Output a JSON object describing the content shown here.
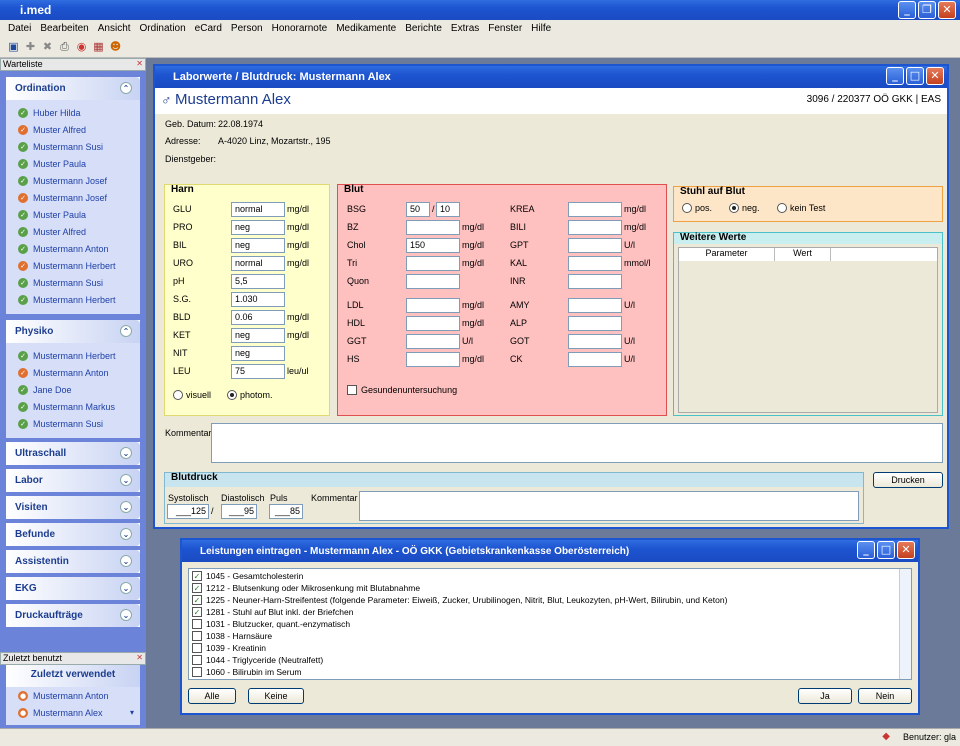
{
  "app": {
    "title": "i.med"
  },
  "menu": [
    "Datei",
    "Bearbeiten",
    "Ansicht",
    "Ordination",
    "eCard",
    "Person",
    "Honorarnote",
    "Medikamente",
    "Berichte",
    "Extras",
    "Fenster",
    "Hilfe"
  ],
  "sidebar": {
    "title": "Warteliste",
    "groups": [
      {
        "label": "Ordination",
        "expanded": true,
        "items": [
          "Huber Hilda",
          "Muster Alfred",
          "Mustermann Susi",
          "Muster Paula",
          "Mustermann Josef",
          "Mustermann Josef",
          "Muster Paula",
          "Muster Alfred",
          "Mustermann Anton",
          "Mustermann Herbert",
          "Mustermann Susi",
          "Mustermann Herbert"
        ]
      },
      {
        "label": "Physiko",
        "expanded": true,
        "items": [
          "Mustermann Herbert",
          "Mustermann Anton",
          "Jane Doe",
          "Mustermann Markus",
          "Mustermann Susi"
        ]
      },
      {
        "label": "Ultraschall"
      },
      {
        "label": "Labor"
      },
      {
        "label": "Visiten"
      },
      {
        "label": "Befunde"
      },
      {
        "label": "Assistentin"
      },
      {
        "label": "EKG"
      },
      {
        "label": "Druckaufträge"
      }
    ],
    "recent_title": "Zuletzt benutzt",
    "recent_heading": "Zuletzt verwendet",
    "recent": [
      "Mustermann Anton",
      "Mustermann Alex"
    ]
  },
  "main": {
    "title": "Laborwerte / Blutdruck: Mustermann Alex",
    "patient_name": "Mustermann Alex",
    "patient_id": "3096 / 220377 OÖ GKK | EAS",
    "geb_label": "Geb. Datum:",
    "geb_value": "22.08.1974",
    "adr_label": "Adresse:",
    "adr_value": "A-4020 Linz, Mozartstr., 195",
    "dienst_label": "Dienstgeber:",
    "harn": {
      "title": "Harn",
      "rows": [
        {
          "label": "GLU",
          "value": "normal",
          "unit": "mg/dl"
        },
        {
          "label": "PRO",
          "value": "neg",
          "unit": "mg/dl"
        },
        {
          "label": "BIL",
          "value": "neg",
          "unit": "mg/dl"
        },
        {
          "label": "URO",
          "value": "normal",
          "unit": "mg/dl"
        },
        {
          "label": "pH",
          "value": "5,5",
          "unit": ""
        },
        {
          "label": "S.G.",
          "value": "1.030",
          "unit": ""
        },
        {
          "label": "BLD",
          "value": "0.06",
          "unit": "mg/dl"
        },
        {
          "label": "KET",
          "value": "neg",
          "unit": "mg/dl"
        },
        {
          "label": "NIT",
          "value": "neg",
          "unit": ""
        },
        {
          "label": "LEU",
          "value": "75",
          "unit": "leu/ul"
        }
      ],
      "radio_visuell": "visuell",
      "radio_photom": "photom."
    },
    "blut": {
      "title": "Blut",
      "left": [
        {
          "label": "BSG",
          "value": "50",
          "value2": "10",
          "unit": ""
        },
        {
          "label": "BZ",
          "value": "",
          "unit": "mg/dl"
        },
        {
          "label": "Chol",
          "value": "150",
          "unit": "mg/dl"
        },
        {
          "label": "Tri",
          "value": "",
          "unit": "mg/dl"
        },
        {
          "label": "Quon",
          "value": "",
          "unit": ""
        },
        {
          "label": "LDL",
          "value": "",
          "unit": "mg/dl"
        },
        {
          "label": "HDL",
          "value": "",
          "unit": "mg/dl"
        },
        {
          "label": "GGT",
          "value": "",
          "unit": "U/l"
        },
        {
          "label": "HS",
          "value": "",
          "unit": "mg/dl"
        }
      ],
      "right": [
        {
          "label": "KREA",
          "unit": "mg/dl"
        },
        {
          "label": "BILI",
          "unit": "mg/dl"
        },
        {
          "label": "GPT",
          "unit": "U/l"
        },
        {
          "label": "KAL",
          "unit": "mmol/l"
        },
        {
          "label": "INR",
          "unit": ""
        },
        {
          "label": "AMY",
          "unit": "U/l"
        },
        {
          "label": "ALP",
          "unit": ""
        },
        {
          "label": "GOT",
          "unit": "U/l"
        },
        {
          "label": "CK",
          "unit": "U/l"
        }
      ],
      "check_label": "Gesundenuntersuchung"
    },
    "stuhl": {
      "title": "Stuhl auf Blut",
      "pos": "pos.",
      "neg": "neg.",
      "kein": "kein Test"
    },
    "weitere": {
      "title": "Weitere Werte",
      "col_param": "Parameter",
      "col_wert": "Wert"
    },
    "kommentar_label": "Kommentar",
    "drucken": "Drucken",
    "blutdruck": {
      "title": "Blutdruck",
      "sys_label": "Systolisch",
      "sys_value": "___125",
      "dia_label": "Diastolisch",
      "dia_value": "___95",
      "puls_label": "Puls",
      "puls_value": "___85",
      "komm_label": "Kommentar",
      "sep": "/"
    }
  },
  "leistungen": {
    "title": "Leistungen eintragen - Mustermann Alex - OÖ GKK (Gebietskrankenkasse Oberösterreich)",
    "items": [
      {
        "text": "1045 - Gesamtcholesterin",
        "checked": true
      },
      {
        "text": "1212 - Blutsenkung oder Mikrosenkung mit Blutabnahme",
        "checked": true
      },
      {
        "text": "1225 - Neuner-Harn-Streifentest (folgende Parameter: Eiweiß, Zucker, Urubilinogen, Nitrit, Blut, Leukozyten, pH-Wert, Bilirubin, und Keton)",
        "checked": true
      },
      {
        "text": "1281 - Stuhl auf Blut inkl. der Briefchen",
        "checked": true
      },
      {
        "text": "1031 - Blutzucker, quant.-enzymatisch",
        "checked": false
      },
      {
        "text": "1038 - Harnsäure",
        "checked": false
      },
      {
        "text": "1039 - Kreatinin",
        "checked": false
      },
      {
        "text": "1044 - Triglyceride (Neutralfett)",
        "checked": false
      },
      {
        "text": "1060 - Bilirubin im Serum",
        "checked": false
      }
    ],
    "alle": "Alle",
    "keine": "Keine",
    "ja": "Ja",
    "nein": "Nein"
  },
  "status": {
    "user": "Benutzer: gla"
  }
}
